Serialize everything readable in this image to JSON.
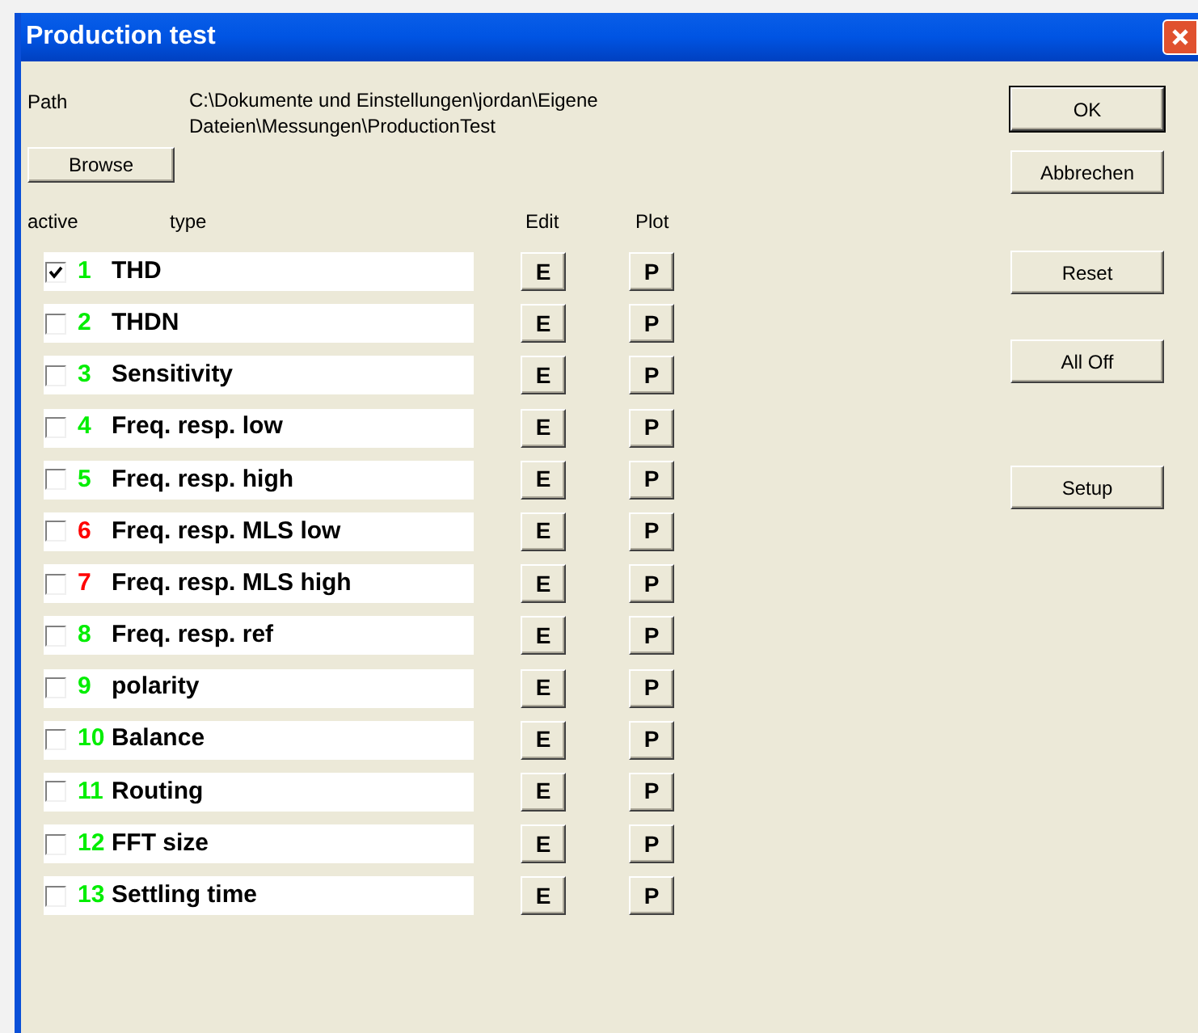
{
  "window": {
    "title": "Production test"
  },
  "path": {
    "label": "Path",
    "value": "C:\\Dokumente und Einstellungen\\jordan\\Eigene Dateien\\Messungen\\ProductionTest"
  },
  "browse_button": "Browse",
  "columns": {
    "active": "active",
    "type": "type",
    "edit": "Edit",
    "plot": "Plot"
  },
  "tests": [
    {
      "number": "1",
      "name": "THD",
      "checked": true,
      "color": "#00ee00",
      "edit": "E",
      "plot": "P"
    },
    {
      "number": "2",
      "name": "THDN",
      "checked": false,
      "color": "#00ee00",
      "edit": "E",
      "plot": "P"
    },
    {
      "number": "3",
      "name": "Sensitivity",
      "checked": false,
      "color": "#00ee00",
      "edit": "E",
      "plot": "P"
    },
    {
      "number": "4",
      "name": "Freq. resp. low",
      "checked": false,
      "color": "#00ee00",
      "edit": "E",
      "plot": "P"
    },
    {
      "number": "5",
      "name": "Freq. resp. high",
      "checked": false,
      "color": "#00ee00",
      "edit": "E",
      "plot": "P"
    },
    {
      "number": "6",
      "name": "Freq. resp. MLS low",
      "checked": false,
      "color": "#ff0000",
      "edit": "E",
      "plot": "P"
    },
    {
      "number": "7",
      "name": "Freq. resp. MLS high",
      "checked": false,
      "color": "#ff0000",
      "edit": "E",
      "plot": "P"
    },
    {
      "number": "8",
      "name": "Freq. resp. ref",
      "checked": false,
      "color": "#00ee00",
      "edit": "E",
      "plot": "P"
    },
    {
      "number": "9",
      "name": "polarity",
      "checked": false,
      "color": "#00ee00",
      "edit": "E",
      "plot": "P"
    },
    {
      "number": "10",
      "name": "Balance",
      "checked": false,
      "color": "#00ee00",
      "edit": "E",
      "plot": "P"
    },
    {
      "number": "11",
      "name": "Routing",
      "checked": false,
      "color": "#00ee00",
      "edit": "E",
      "plot": "P"
    },
    {
      "number": "12",
      "name": "FFT size",
      "checked": false,
      "color": "#00ee00",
      "edit": "E",
      "plot": "P"
    },
    {
      "number": "13",
      "name": "Settling time",
      "checked": false,
      "color": "#00ee00",
      "edit": "E",
      "plot": "P"
    }
  ],
  "buttons": [
    {
      "label": "OK",
      "default": true
    },
    {
      "label": "Abbrechen",
      "default": false
    },
    {
      "label": "Reset",
      "default": false
    },
    {
      "label": "All Off",
      "default": false
    },
    {
      "label": "Setup",
      "default": false
    }
  ]
}
